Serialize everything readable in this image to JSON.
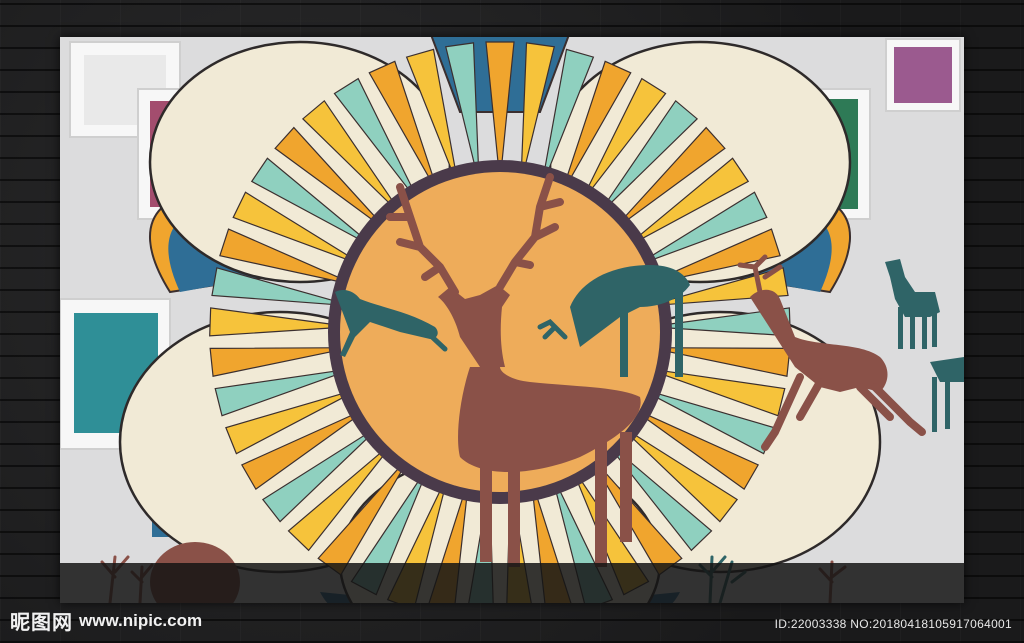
{
  "watermark": {
    "brand": "昵图网",
    "site": "www.nipic.com",
    "id_text": "ID:22003338 NO:20180418105917064001"
  },
  "colors": {
    "cream": "#f1ead6",
    "orange": "#f0a52e",
    "yellow": "#f6c33b",
    "mint": "#8fd0bf",
    "blue": "#2f6e96",
    "sun": "#eeac5a",
    "ring": "#4a3a4a",
    "deer_brown": "#8a5148",
    "deer_teal": "#2f6467",
    "frame_pink": "#a34d6e",
    "frame_green": "#2e7a56",
    "frame_teal": "#2f8f97",
    "frame_violet": "#9b5a8f"
  }
}
